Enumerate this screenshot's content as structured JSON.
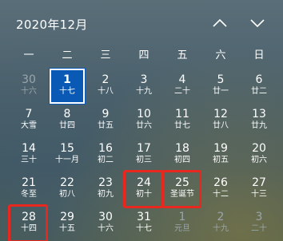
{
  "header": {
    "month_title": "2020年12月",
    "prev_icon": "chevron-up-icon",
    "next_icon": "chevron-down-icon"
  },
  "weekdays": [
    "一",
    "二",
    "三",
    "四",
    "五",
    "六",
    "日"
  ],
  "colors": {
    "today_bg": "#0a5ab5",
    "highlight_border": "#e8281e",
    "dim_text": "#9aa6ab"
  },
  "weeks": [
    [
      {
        "day": "30",
        "lunar": "十六",
        "dim": true
      },
      {
        "day": "1",
        "lunar": "十七",
        "today": true
      },
      {
        "day": "2",
        "lunar": "十八"
      },
      {
        "day": "3",
        "lunar": "十九"
      },
      {
        "day": "4",
        "lunar": "二十"
      },
      {
        "day": "5",
        "lunar": "廿一"
      },
      {
        "day": "6",
        "lunar": "廿二"
      }
    ],
    [
      {
        "day": "7",
        "lunar": "大雪"
      },
      {
        "day": "8",
        "lunar": "廿四"
      },
      {
        "day": "9",
        "lunar": "廿五"
      },
      {
        "day": "10",
        "lunar": "廿六"
      },
      {
        "day": "11",
        "lunar": "廿七"
      },
      {
        "day": "12",
        "lunar": "廿八"
      },
      {
        "day": "13",
        "lunar": "廿九"
      }
    ],
    [
      {
        "day": "14",
        "lunar": "三十"
      },
      {
        "day": "15",
        "lunar": "十一月"
      },
      {
        "day": "16",
        "lunar": "初二"
      },
      {
        "day": "17",
        "lunar": "初三"
      },
      {
        "day": "18",
        "lunar": "初四"
      },
      {
        "day": "19",
        "lunar": "初五"
      },
      {
        "day": "20",
        "lunar": "初六"
      }
    ],
    [
      {
        "day": "21",
        "lunar": "冬至"
      },
      {
        "day": "22",
        "lunar": "初八"
      },
      {
        "day": "23",
        "lunar": "初九"
      },
      {
        "day": "24",
        "lunar": "初十",
        "marked": true
      },
      {
        "day": "25",
        "lunar": "圣诞节",
        "marked": true
      },
      {
        "day": "26",
        "lunar": "十二"
      },
      {
        "day": "27",
        "lunar": "十三"
      }
    ],
    [
      {
        "day": "28",
        "lunar": "十四",
        "marked": true
      },
      {
        "day": "29",
        "lunar": "十五"
      },
      {
        "day": "30",
        "lunar": "十六"
      },
      {
        "day": "31",
        "lunar": "十七"
      },
      {
        "day": "1",
        "lunar": "元旦",
        "dim": true
      },
      {
        "day": "2",
        "lunar": "十九",
        "dim": true
      },
      {
        "day": "3",
        "lunar": "二十",
        "dim": true
      }
    ]
  ]
}
